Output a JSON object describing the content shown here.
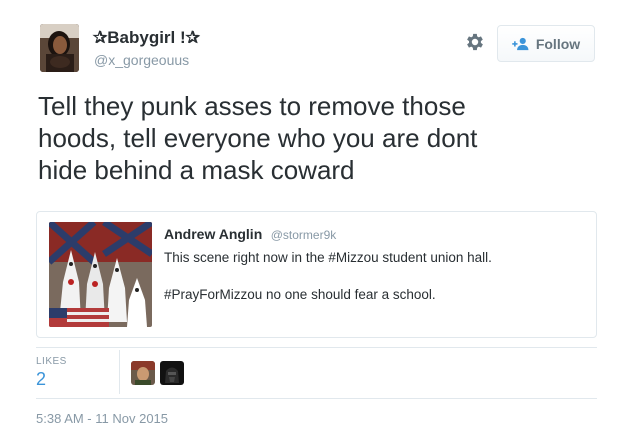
{
  "author": {
    "display_name": "✰Babygirl !✰",
    "handle": "@x_gorgeouus"
  },
  "actions": {
    "follow_label": "Follow"
  },
  "tweet": {
    "lines": [
      "Tell they punk asses to remove those",
      "hoods, tell everyone who you are dont",
      "hide behind a mask coward"
    ]
  },
  "quoted_tweet": {
    "name": "Andrew Anglin",
    "handle": "@stormer9k",
    "line1": "This scene right now in the #Mizzou student union hall.",
    "line2": "#PrayForMizzou no one should fear a school."
  },
  "stats": {
    "likes_label": "LIKES",
    "likes_count": "2"
  },
  "timestamp": "5:38 AM - 11 Nov 2015",
  "colors": {
    "link_blue": "#3b94d9",
    "muted": "#8899a6",
    "text": "#292f33",
    "border": "#e1e8ed"
  },
  "icons": [
    "gear-icon",
    "follow-person-plus-icon"
  ]
}
